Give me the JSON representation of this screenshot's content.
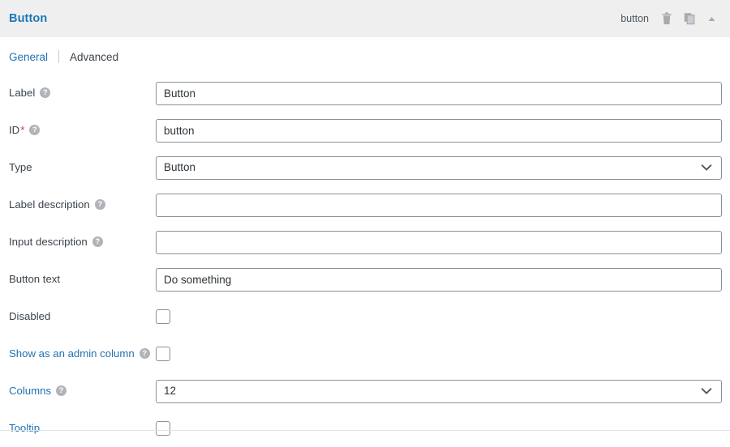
{
  "header": {
    "title": "Button",
    "field_key": "button",
    "actions": [
      {
        "name": "delete-icon",
        "label": "Delete"
      },
      {
        "name": "duplicate-icon",
        "label": "Duplicate"
      },
      {
        "name": "collapse-icon",
        "label": "Collapse"
      }
    ]
  },
  "tabs": [
    {
      "label": "General",
      "active": true
    },
    {
      "label": "Advanced",
      "active": false
    }
  ],
  "fields": {
    "label": {
      "label": "Label",
      "value": "Button",
      "placeholder": ""
    },
    "id": {
      "label": "ID",
      "required_mark": "*",
      "value": "button",
      "placeholder": ""
    },
    "type": {
      "label": "Type",
      "value": "Button"
    },
    "label_description": {
      "label": "Label description",
      "value": "",
      "placeholder": ""
    },
    "input_description": {
      "label": "Input description",
      "value": "",
      "placeholder": ""
    },
    "button_text": {
      "label": "Button text",
      "value": "Do something",
      "placeholder": ""
    },
    "disabled": {
      "label": "Disabled",
      "checked": false
    },
    "admin_column": {
      "label": "Show as an admin column",
      "checked": false
    },
    "columns": {
      "label": "Columns",
      "value": "12"
    },
    "tooltip": {
      "label": "Tooltip",
      "checked": false
    }
  },
  "help_glyph": "?",
  "colors": {
    "accent": "#2271b1",
    "title": "#1d77b5",
    "required": "#d63638",
    "header_bg": "#efefef",
    "border": "#8c8f94",
    "text": "#3c434a"
  }
}
